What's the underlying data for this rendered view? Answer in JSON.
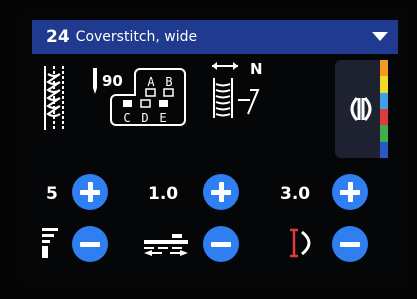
{
  "header": {
    "stitch_number": "24",
    "stitch_name": "Coverstitch, wide"
  },
  "needle": {
    "value": "90"
  },
  "needle_positions": {
    "top_labels": [
      "A",
      "B"
    ],
    "bottom_labels": [
      "C",
      "D",
      "E"
    ]
  },
  "stitch_width": {
    "label": "N"
  },
  "side_panel": {
    "icon": "presser-foot-pair-icon",
    "color_strip": [
      "#f39a26",
      "#f3d72a",
      "#3f9fe8",
      "#e03b3b",
      "#3fae4a",
      "#2a56c8"
    ]
  },
  "controls": {
    "width": {
      "value": "5"
    },
    "length": {
      "value": "1.0"
    },
    "tension": {
      "value": "3.0"
    }
  },
  "colors": {
    "header_bg": "#1f3a8e",
    "button_blue": "#2f7ff0",
    "accent_red": "#e03b3b"
  }
}
